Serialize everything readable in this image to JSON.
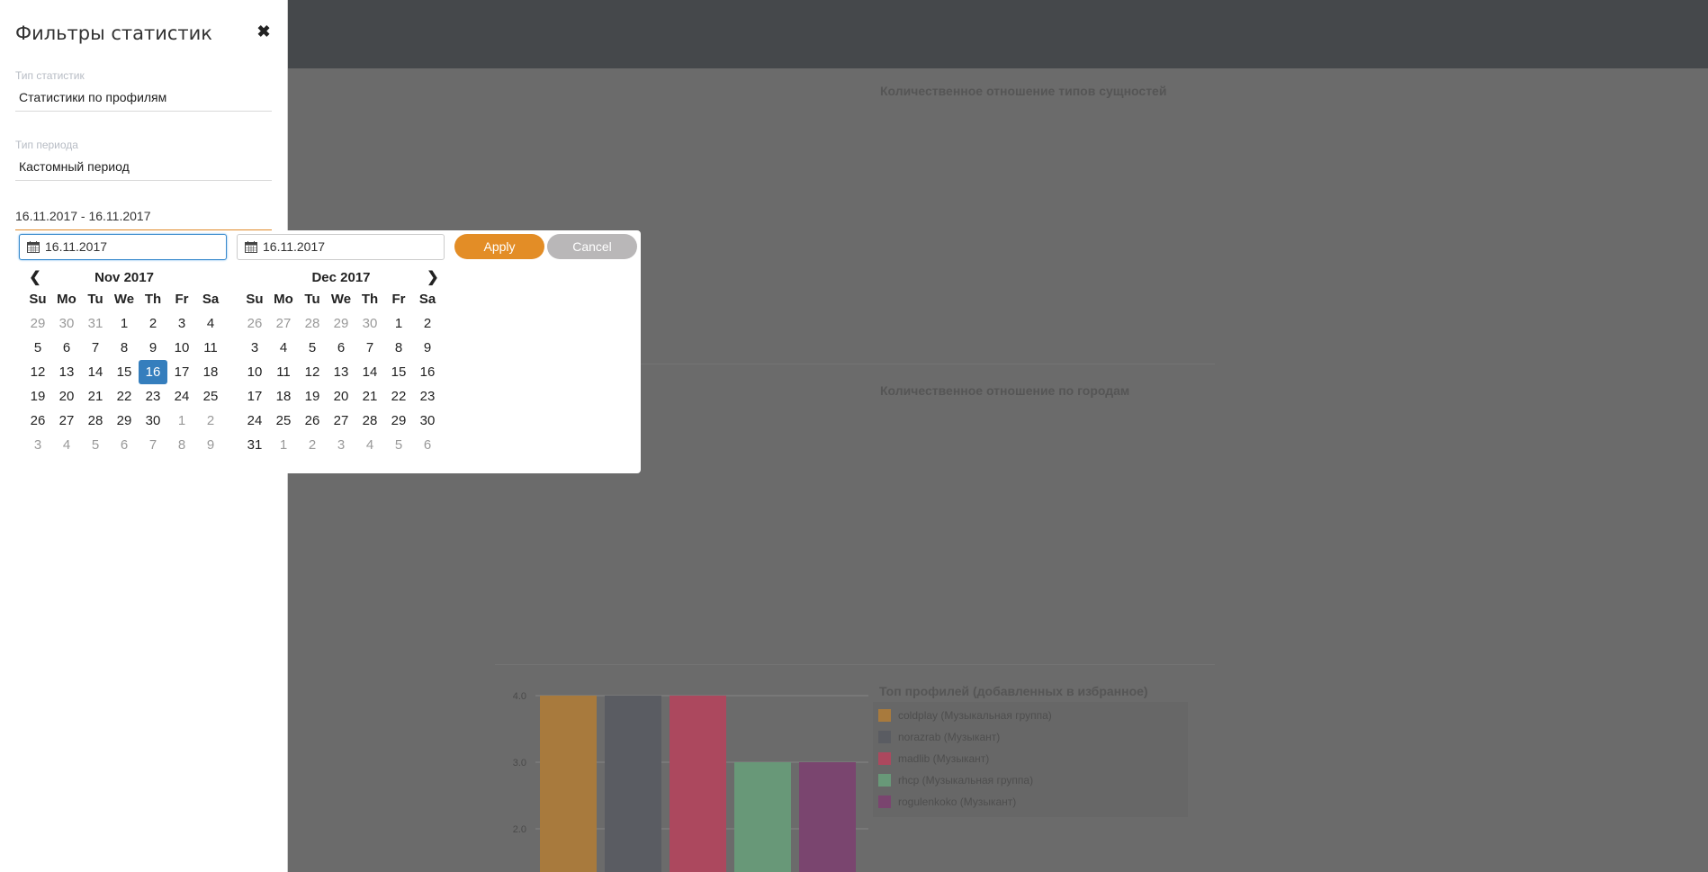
{
  "background": {
    "section_titles": [
      "Количественное отношение типов сущностей",
      "Количественное отношение по городам"
    ],
    "chart_data": {
      "type": "bar",
      "title": "Топ профилей (добавленных в избранное)",
      "categories": [
        "coldplay (Музыкальная группа)",
        "norazrab (Музыкант)",
        "madlib (Музыкант)",
        "rhcp (Музыкальная группа)",
        "rogulenkoko (Музыкант)"
      ],
      "values": [
        4,
        4,
        4,
        3,
        3
      ],
      "colors": [
        "#a87a3d",
        "#5a5c62",
        "#ac485e",
        "#689878",
        "#7a456f"
      ],
      "y_ticks": [
        "4.0",
        "3.0",
        "2.0"
      ],
      "grid": true,
      "legend_position": "right"
    }
  },
  "sidebar": {
    "title": "Фильтры статистик",
    "stat_type_label": "Тип статистик",
    "stat_type_value": "Статистики по профилям",
    "period_type_label": "Тип периода",
    "period_type_value": "Кастомный период",
    "date_range_value": "16.11.2017 - 16.11.2017"
  },
  "picker": {
    "start_date": "16.11.2017",
    "end_date": "16.11.2017",
    "apply_label": "Apply",
    "cancel_label": "Cancel",
    "weekdays": [
      "Su",
      "Mo",
      "Tu",
      "We",
      "Th",
      "Fr",
      "Sa"
    ],
    "left_month": {
      "title": "Nov 2017",
      "days": [
        {
          "d": "29",
          "off": true
        },
        {
          "d": "30",
          "off": true
        },
        {
          "d": "31",
          "off": true
        },
        {
          "d": "1"
        },
        {
          "d": "2"
        },
        {
          "d": "3"
        },
        {
          "d": "4"
        },
        {
          "d": "5"
        },
        {
          "d": "6"
        },
        {
          "d": "7"
        },
        {
          "d": "8"
        },
        {
          "d": "9"
        },
        {
          "d": "10"
        },
        {
          "d": "11"
        },
        {
          "d": "12"
        },
        {
          "d": "13"
        },
        {
          "d": "14"
        },
        {
          "d": "15"
        },
        {
          "d": "16",
          "sel": true
        },
        {
          "d": "17"
        },
        {
          "d": "18"
        },
        {
          "d": "19"
        },
        {
          "d": "20"
        },
        {
          "d": "21"
        },
        {
          "d": "22"
        },
        {
          "d": "23"
        },
        {
          "d": "24"
        },
        {
          "d": "25"
        },
        {
          "d": "26"
        },
        {
          "d": "27"
        },
        {
          "d": "28"
        },
        {
          "d": "29"
        },
        {
          "d": "30"
        },
        {
          "d": "1",
          "off": true
        },
        {
          "d": "2",
          "off": true
        },
        {
          "d": "3",
          "off": true
        },
        {
          "d": "4",
          "off": true
        },
        {
          "d": "5",
          "off": true
        },
        {
          "d": "6",
          "off": true
        },
        {
          "d": "7",
          "off": true
        },
        {
          "d": "8",
          "off": true
        },
        {
          "d": "9",
          "off": true
        }
      ]
    },
    "right_month": {
      "title": "Dec 2017",
      "days": [
        {
          "d": "26",
          "off": true
        },
        {
          "d": "27",
          "off": true
        },
        {
          "d": "28",
          "off": true
        },
        {
          "d": "29",
          "off": true
        },
        {
          "d": "30",
          "off": true
        },
        {
          "d": "1"
        },
        {
          "d": "2"
        },
        {
          "d": "3"
        },
        {
          "d": "4"
        },
        {
          "d": "5"
        },
        {
          "d": "6"
        },
        {
          "d": "7"
        },
        {
          "d": "8"
        },
        {
          "d": "9"
        },
        {
          "d": "10"
        },
        {
          "d": "11"
        },
        {
          "d": "12"
        },
        {
          "d": "13"
        },
        {
          "d": "14"
        },
        {
          "d": "15"
        },
        {
          "d": "16"
        },
        {
          "d": "17"
        },
        {
          "d": "18"
        },
        {
          "d": "19"
        },
        {
          "d": "20"
        },
        {
          "d": "21"
        },
        {
          "d": "22"
        },
        {
          "d": "23"
        },
        {
          "d": "24"
        },
        {
          "d": "25"
        },
        {
          "d": "26"
        },
        {
          "d": "27"
        },
        {
          "d": "28"
        },
        {
          "d": "29"
        },
        {
          "d": "30"
        },
        {
          "d": "31"
        },
        {
          "d": "1",
          "off": true
        },
        {
          "d": "2",
          "off": true
        },
        {
          "d": "3",
          "off": true
        },
        {
          "d": "4",
          "off": true
        },
        {
          "d": "5",
          "off": true
        },
        {
          "d": "6",
          "off": true
        }
      ]
    }
  }
}
